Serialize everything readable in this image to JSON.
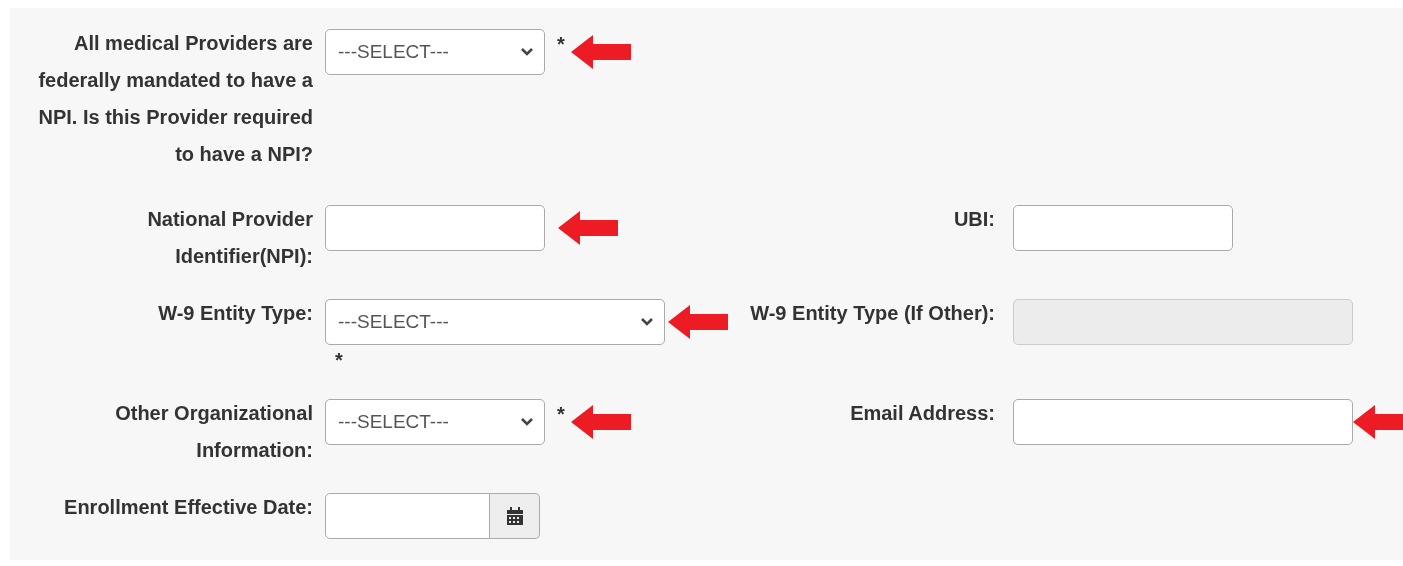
{
  "rows": [
    {
      "left": {
        "label": "All medical Providers are federally mandated to have a NPI. Is this Provider required to have a NPI?",
        "kind": "select",
        "value": "---SELECT---",
        "required_mark": "*",
        "arrow": true
      }
    },
    {
      "left": {
        "label": "National Provider Identifier(NPI):",
        "kind": "text",
        "arrow": true
      },
      "right": {
        "label": "UBI:",
        "kind": "text"
      }
    },
    {
      "left": {
        "label": "W-9 Entity Type:",
        "kind": "wide-select",
        "value": "---SELECT---",
        "required_mark": "*",
        "arrow": true
      },
      "right": {
        "label": "W-9 Entity Type (If Other):",
        "kind": "wide-text",
        "disabled": true
      }
    },
    {
      "left": {
        "label": "Other Organizational Information:",
        "kind": "select",
        "value": "---SELECT---",
        "required_mark": "*",
        "arrow": true
      },
      "right": {
        "label": "Email Address:",
        "kind": "wide-text",
        "arrow": true
      }
    },
    {
      "left": {
        "label": "Enrollment Effective Date:",
        "kind": "date"
      }
    }
  ]
}
